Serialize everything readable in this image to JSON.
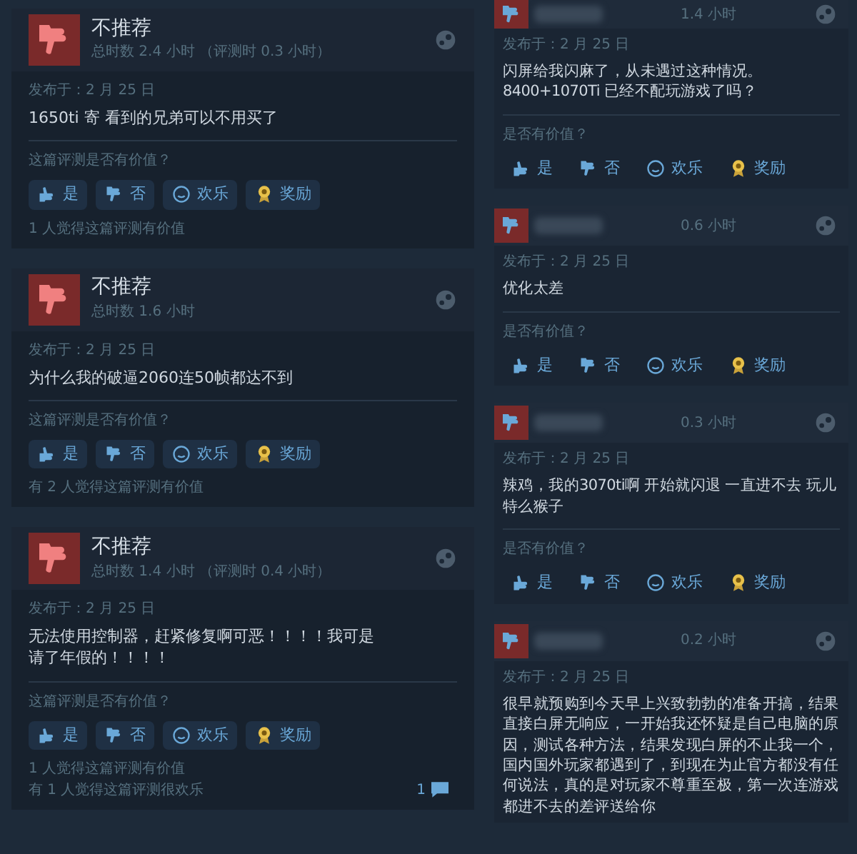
{
  "left_reviews": [
    {
      "verdict": "不推荐",
      "playtime": "总时数 2.4 小时 （评测时 0.3 小时）",
      "date": "发布于：2 月 25 日",
      "text": "1650ti 寄 看到的兄弟可以不用买了",
      "question": "这篇评测是否有价值？",
      "buttons": [
        {
          "kind": "up",
          "label": "是"
        },
        {
          "kind": "down",
          "label": "否"
        },
        {
          "kind": "smile",
          "label": "欢乐"
        },
        {
          "kind": "award",
          "label": "奖励"
        }
      ],
      "helpful": [
        "1 人觉得这篇评测有价值"
      ]
    },
    {
      "verdict": "不推荐",
      "playtime": "总时数 1.6 小时",
      "date": "发布于：2 月 25 日",
      "text": "为什么我的破逼2060连50帧都达不到",
      "question": "这篇评测是否有价值？",
      "buttons": [
        {
          "kind": "up",
          "label": "是"
        },
        {
          "kind": "down",
          "label": "否"
        },
        {
          "kind": "smile",
          "label": "欢乐"
        },
        {
          "kind": "award",
          "label": "奖励"
        }
      ],
      "helpful": [
        "有 2 人觉得这篇评测有价值"
      ]
    },
    {
      "verdict": "不推荐",
      "playtime": "总时数 1.4 小时 （评测时 0.4 小时）",
      "date": "发布于：2 月 25 日",
      "text": "无法使用控制器，赶紧修复啊可恶！！！！我可是请了年假的！！！！",
      "question": "这篇评测是否有价值？",
      "buttons": [
        {
          "kind": "up",
          "label": "是"
        },
        {
          "kind": "down",
          "label": "否"
        },
        {
          "kind": "smile",
          "label": "欢乐"
        },
        {
          "kind": "award",
          "label": "奖励"
        }
      ],
      "helpful": [
        "1 人觉得这篇评测有价值",
        "有 1 人觉得这篇评测很欢乐"
      ],
      "comments": "1"
    }
  ],
  "right_reviews": [
    {
      "playtime": "1.4 小时",
      "date": "发布于：2 月 25 日",
      "text": "闪屏给我闪麻了，从未遇过这种情况。8400+1070Ti 已经不配玩游戏了吗？",
      "question": "是否有价值？",
      "buttons": [
        {
          "kind": "up",
          "label": "是"
        },
        {
          "kind": "down",
          "label": "否"
        },
        {
          "kind": "smile",
          "label": "欢乐"
        },
        {
          "kind": "award",
          "label": "奖励"
        }
      ]
    },
    {
      "playtime": "0.6 小时",
      "date": "发布于：2 月 25 日",
      "text": "优化太差",
      "question": "是否有价值？",
      "buttons": [
        {
          "kind": "up",
          "label": "是"
        },
        {
          "kind": "down",
          "label": "否"
        },
        {
          "kind": "smile",
          "label": "欢乐"
        },
        {
          "kind": "award",
          "label": "奖励"
        }
      ]
    },
    {
      "playtime": "0.3 小时",
      "date": "发布于：2 月 25 日",
      "text": "辣鸡，我的3070ti啊 开始就闪退 一直进不去 玩儿特么猴子",
      "question": "是否有价值？",
      "buttons": [
        {
          "kind": "up",
          "label": "是"
        },
        {
          "kind": "down",
          "label": "否"
        },
        {
          "kind": "smile",
          "label": "欢乐"
        },
        {
          "kind": "award",
          "label": "奖励"
        }
      ]
    },
    {
      "playtime": "0.2 小时",
      "date": "发布于：2 月 25 日",
      "text": "很早就预购到今天早上兴致勃勃的准备开搞，结果直接白屏无响应，一开始我还怀疑是自己电脑的原因，测试各种方法，结果发现白屏的不止我一个，国内国外玩家都遇到了，到现在为止官方都没有任何说法，真的是对玩家不尊重至极，第一次连游戏都进不去的差评送给你"
    }
  ]
}
